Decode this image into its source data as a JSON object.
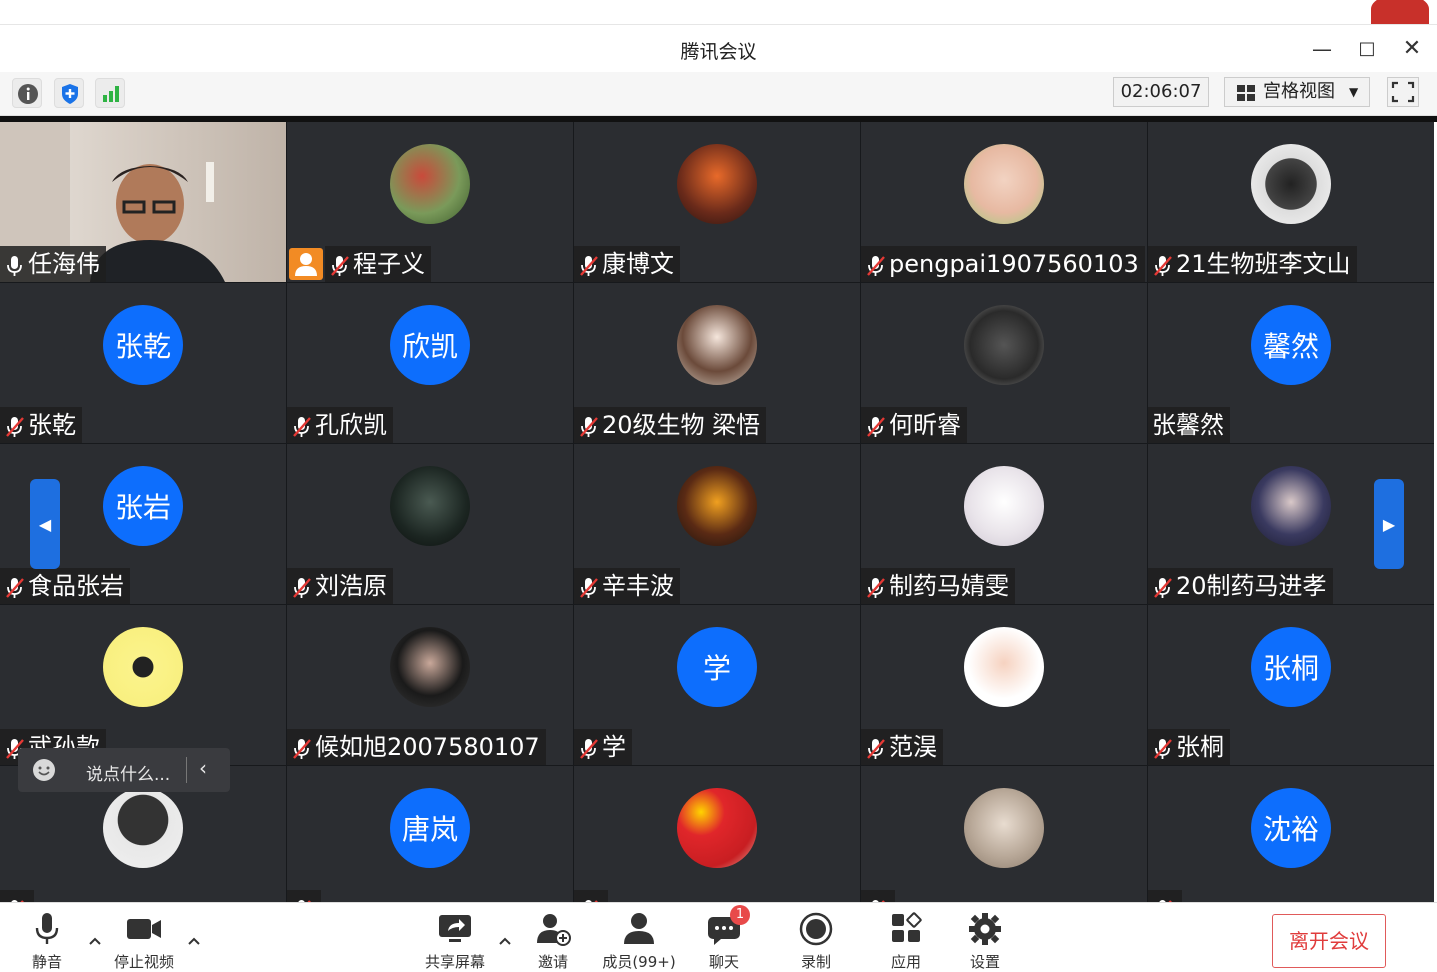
{
  "window": {
    "title": "腾讯会议"
  },
  "toolbar": {
    "timer": "02:06:07",
    "view_label": "宫格视图"
  },
  "participants": [
    {
      "name": "任海伟",
      "avatar_text": "",
      "muted": false,
      "video": true,
      "host": false
    },
    {
      "name": "程子义",
      "avatar_text": "",
      "muted": true,
      "video": false,
      "host": true
    },
    {
      "name": "康博文",
      "avatar_text": "",
      "muted": true,
      "video": false,
      "host": false
    },
    {
      "name": "pengpai1907560103",
      "avatar_text": "",
      "muted": true,
      "video": false,
      "host": false
    },
    {
      "name": "21生物班李文山",
      "avatar_text": "",
      "muted": true,
      "video": false,
      "host": false
    },
    {
      "name": "张乾",
      "avatar_text": "张乾",
      "muted": true,
      "video": false,
      "host": false
    },
    {
      "name": "孔欣凯",
      "avatar_text": "欣凯",
      "muted": true,
      "video": false,
      "host": false
    },
    {
      "name": "20级生物 梁悟",
      "avatar_text": "",
      "muted": true,
      "video": false,
      "host": false
    },
    {
      "name": "何昕睿",
      "avatar_text": "",
      "muted": true,
      "video": false,
      "host": false
    },
    {
      "name": "张馨然",
      "avatar_text": "馨然",
      "muted": false,
      "video": false,
      "host": false
    },
    {
      "name": "食品张岩",
      "avatar_text": "张岩",
      "muted": true,
      "video": false,
      "host": false
    },
    {
      "name": "刘浩原",
      "avatar_text": "",
      "muted": true,
      "video": false,
      "host": false
    },
    {
      "name": "辛丰波",
      "avatar_text": "",
      "muted": true,
      "video": false,
      "host": false
    },
    {
      "name": "制药马婧雯",
      "avatar_text": "",
      "muted": true,
      "video": false,
      "host": false
    },
    {
      "name": "20制药马进孝",
      "avatar_text": "",
      "muted": true,
      "video": false,
      "host": false
    },
    {
      "name": "武孙款",
      "avatar_text": "",
      "muted": true,
      "video": false,
      "host": false
    },
    {
      "name": "候如旭2007580107",
      "avatar_text": "",
      "muted": true,
      "video": false,
      "host": false
    },
    {
      "name": "学",
      "avatar_text": "学",
      "muted": true,
      "video": false,
      "host": false
    },
    {
      "name": "范淏",
      "avatar_text": "",
      "muted": true,
      "video": false,
      "host": false
    },
    {
      "name": "张桐",
      "avatar_text": "张桐",
      "muted": true,
      "video": false,
      "host": false
    },
    {
      "name": "",
      "avatar_text": "",
      "muted": true,
      "video": false,
      "host": false
    },
    {
      "name": "",
      "avatar_text": "唐岚",
      "muted": true,
      "video": false,
      "host": false
    },
    {
      "name": "",
      "avatar_text": "",
      "muted": true,
      "video": false,
      "host": false
    },
    {
      "name": "",
      "avatar_text": "",
      "muted": true,
      "video": false,
      "host": false
    },
    {
      "name": "",
      "avatar_text": "沈裕",
      "muted": true,
      "video": false,
      "host": false
    }
  ],
  "chat_popup": {
    "placeholder": "说点什么..."
  },
  "bottom": {
    "mute": "静音",
    "stop_video": "停止视频",
    "share": "共享屏幕",
    "invite": "邀请",
    "members": "成员(99+)",
    "chat": "聊天",
    "chat_badge": "1",
    "record": "录制",
    "apps": "应用",
    "settings": "设置",
    "leave": "离开会议"
  },
  "colors": {
    "accent": "#0d6efd",
    "tile_bg": "#2b2d31",
    "leave_red": "#e03c3c",
    "host_orange": "#f28b24"
  }
}
